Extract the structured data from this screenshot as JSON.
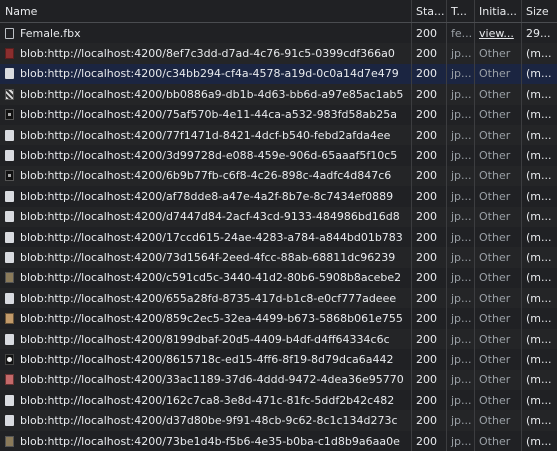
{
  "columns": {
    "name": "Name",
    "status": "Sta...",
    "type": "T...",
    "initiator": "Initia...",
    "size": "Size"
  },
  "rows": [
    {
      "name": "Female.fbx",
      "status": "200",
      "type": "fe...",
      "initiator": "view...",
      "size": "29...",
      "icon": "doc-icon",
      "style": "doc",
      "init_link": true
    },
    {
      "name": "blob:http://localhost:4200/8ef7c3dd-d7ad-4c76-91c5-0399cdf366a0",
      "status": "200",
      "type": "jp...",
      "initiator": "Other",
      "size": "(m...",
      "icon": "image-icon",
      "style": "img-red",
      "init_link": false
    },
    {
      "name": "blob:http://localhost:4200/c34bb294-cf4a-4578-a19d-0c0a14d7e479",
      "status": "200",
      "type": "jp...",
      "initiator": "Other",
      "size": "(m...",
      "icon": "image-icon",
      "style": "doc-filled",
      "init_link": false
    },
    {
      "name": "blob:http://localhost:4200/bb0886a9-db1b-4d63-bb6d-a97e85ac1ab5",
      "status": "200",
      "type": "jp...",
      "initiator": "Other",
      "size": "(m...",
      "icon": "image-icon",
      "style": "img-check",
      "init_link": false
    },
    {
      "name": "blob:http://localhost:4200/75af570b-4e11-44ca-a532-983fd58ab25a",
      "status": "200",
      "type": "jp...",
      "initiator": "Other",
      "size": "(m...",
      "icon": "image-icon",
      "style": "img-dark",
      "init_link": false
    },
    {
      "name": "blob:http://localhost:4200/77f1471d-8421-4dcf-b540-febd2afda4ee",
      "status": "200",
      "type": "jp...",
      "initiator": "Other",
      "size": "(m...",
      "icon": "image-icon",
      "style": "doc-filled",
      "init_link": false
    },
    {
      "name": "blob:http://localhost:4200/3d99728d-e088-459e-906d-65aaaf5f10c5",
      "status": "200",
      "type": "jp...",
      "initiator": "Other",
      "size": "(m...",
      "icon": "image-icon",
      "style": "doc-filled",
      "init_link": false
    },
    {
      "name": "blob:http://localhost:4200/6b9b77fb-c6f8-4c26-898c-4adfc4d847c6",
      "status": "200",
      "type": "jp...",
      "initiator": "Other",
      "size": "(m...",
      "icon": "image-icon",
      "style": "img-dark",
      "init_link": false
    },
    {
      "name": "blob:http://localhost:4200/af78dde8-a47e-4a2f-8b7e-8c7434ef0889",
      "status": "200",
      "type": "jp...",
      "initiator": "Other",
      "size": "(m...",
      "icon": "image-icon",
      "style": "doc-filled",
      "init_link": false
    },
    {
      "name": "blob:http://localhost:4200/d7447d84-2acf-43cd-9133-484986bd16d8",
      "status": "200",
      "type": "jp...",
      "initiator": "Other",
      "size": "(m...",
      "icon": "image-icon",
      "style": "doc-filled",
      "init_link": false
    },
    {
      "name": "blob:http://localhost:4200/17ccd615-24ae-4283-a784-a844bd01b783",
      "status": "200",
      "type": "jp...",
      "initiator": "Other",
      "size": "(m...",
      "icon": "image-icon",
      "style": "doc-filled",
      "init_link": false
    },
    {
      "name": "blob:http://localhost:4200/73d1564f-2eed-4fcc-88ab-68811dc96239",
      "status": "200",
      "type": "jp...",
      "initiator": "Other",
      "size": "(m...",
      "icon": "image-icon",
      "style": "doc-filled",
      "init_link": false
    },
    {
      "name": "blob:http://localhost:4200/c591cd5c-3440-41d2-80b6-5908b8acebe2",
      "status": "200",
      "type": "jp...",
      "initiator": "Other",
      "size": "(m...",
      "icon": "image-icon",
      "style": "img-tan",
      "init_link": false
    },
    {
      "name": "blob:http://localhost:4200/655a28fd-8735-417d-b1c8-e0cf777adeee",
      "status": "200",
      "type": "jp...",
      "initiator": "Other",
      "size": "(m...",
      "icon": "image-icon",
      "style": "doc-filled",
      "init_link": false
    },
    {
      "name": "blob:http://localhost:4200/859c2ec5-32ea-4499-b673-5868b061e755",
      "status": "200",
      "type": "jp...",
      "initiator": "Other",
      "size": "(m...",
      "icon": "image-icon",
      "style": "img-warm",
      "init_link": false
    },
    {
      "name": "blob:http://localhost:4200/8199dbaf-20d5-4409-b4df-d4ff64334c6c",
      "status": "200",
      "type": "jp...",
      "initiator": "Other",
      "size": "(m...",
      "icon": "image-icon",
      "style": "doc-filled",
      "init_link": false
    },
    {
      "name": "blob:http://localhost:4200/8615718c-ed15-4ff6-8f19-8d79dca6a442",
      "status": "200",
      "type": "jp...",
      "initiator": "Other",
      "size": "(m...",
      "icon": "image-icon",
      "style": "img-white-dot",
      "init_link": false
    },
    {
      "name": "blob:http://localhost:4200/33ac1189-37d6-4ddd-9472-4dea36e95770",
      "status": "200",
      "type": "jp...",
      "initiator": "Other",
      "size": "(m...",
      "icon": "image-icon",
      "style": "img-pink",
      "init_link": false
    },
    {
      "name": "blob:http://localhost:4200/162c7ca8-3e8d-471c-81fc-5ddf2b42c482",
      "status": "200",
      "type": "jp...",
      "initiator": "Other",
      "size": "(m...",
      "icon": "image-icon",
      "style": "doc-filled",
      "init_link": false
    },
    {
      "name": "blob:http://localhost:4200/d37d80be-9f91-48cb-9c62-8c1c134d273c",
      "status": "200",
      "type": "jp...",
      "initiator": "Other",
      "size": "(m...",
      "icon": "image-icon",
      "style": "doc-filled",
      "init_link": false
    },
    {
      "name": "blob:http://localhost:4200/73be1d4b-f5b6-4e35-b0ba-c1d8b9a6aa0e",
      "status": "200",
      "type": "jp...",
      "initiator": "Other",
      "size": "(m...",
      "icon": "image-icon",
      "style": "img-tan",
      "init_link": false
    }
  ],
  "selected_row_index": 2,
  "colors": {
    "background": "#202124",
    "row_alt": "#242527",
    "selected": "#1b2541",
    "text": "#e8eaed",
    "muted": "#9aa0a6"
  }
}
